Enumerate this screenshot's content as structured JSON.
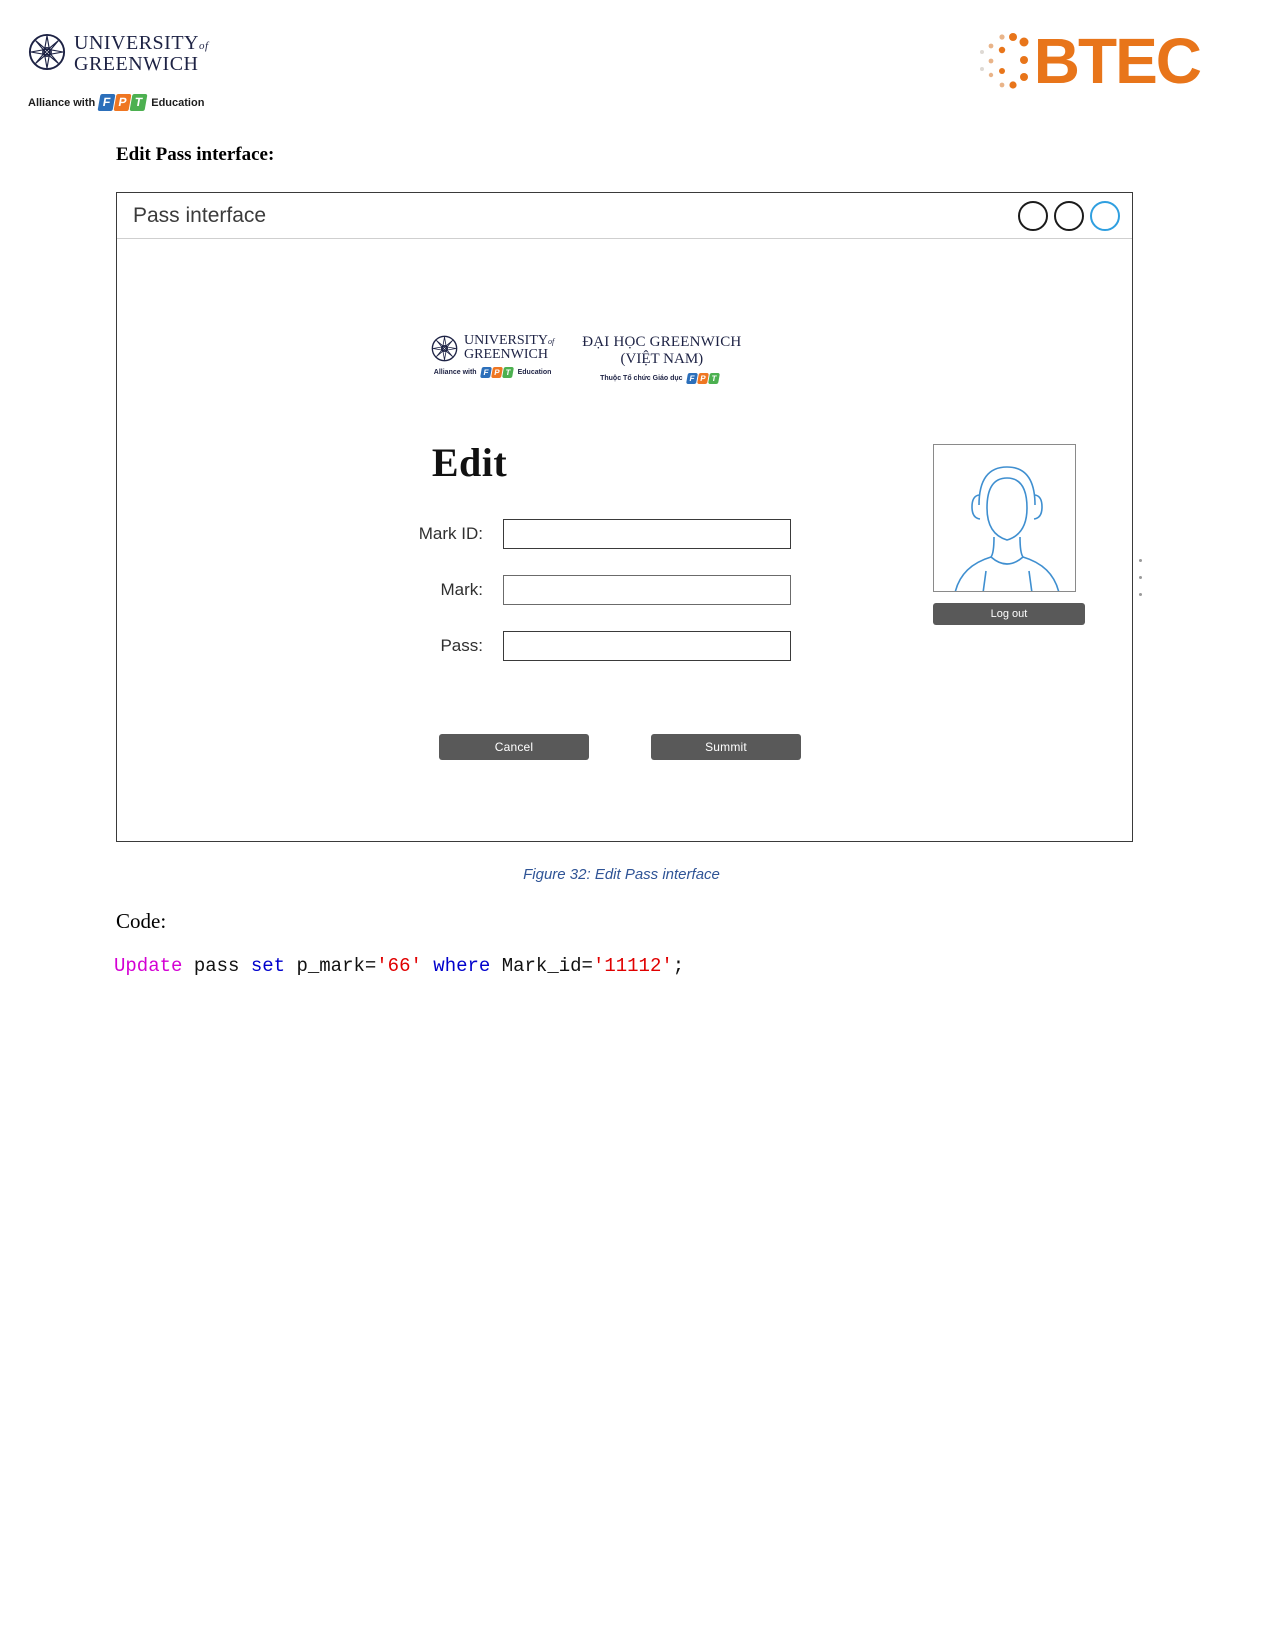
{
  "header": {
    "university": {
      "line1": "UNIVERSITY",
      "of": "of",
      "line2": "GREENWICH"
    },
    "alliance": {
      "prefix": "Alliance with",
      "f": "F",
      "p": "P",
      "t": "T",
      "suffix": "Education"
    },
    "btec": {
      "word": "BTEC",
      "color": "#e8751a"
    }
  },
  "document": {
    "section_title": "Edit Pass interface:",
    "figure_caption": "Figure 32: Edit Pass interface",
    "code_label": "Code:"
  },
  "window": {
    "title": "Pass interface",
    "controls": [
      {
        "name": "minimize",
        "color": "#1b1b1b"
      },
      {
        "name": "maximize",
        "color": "#1b1b1b"
      },
      {
        "name": "close",
        "color": "#2f9fe0"
      }
    ]
  },
  "form": {
    "logo_left": {
      "line1": "UNIVERSITY",
      "of": "of",
      "line2": "GREENWICH",
      "sub_prefix": "Alliance with",
      "sub_suffix": "Education"
    },
    "logo_right": {
      "line1": "ĐẠI HỌC GREENWICH",
      "line2": "(VIỆT NAM)",
      "sub_prefix": "Thuộc Tổ chức Giáo dục"
    },
    "heading": "Edit",
    "fields": [
      {
        "label": "Mark ID:",
        "value": "",
        "placeholder": ""
      },
      {
        "label": "Mark:",
        "value": "",
        "placeholder": ""
      },
      {
        "label": "Pass:",
        "value": "",
        "placeholder": ""
      }
    ],
    "buttons": {
      "cancel": "Cancel",
      "submit": "Summit"
    },
    "logout": "Log out"
  },
  "code": {
    "tokens": [
      {
        "text": "Update",
        "style": "kw-magenta"
      },
      {
        "text": " pass ",
        "style": "plain"
      },
      {
        "text": "set",
        "style": "kw-blue"
      },
      {
        "text": " p_mark=",
        "style": "plain"
      },
      {
        "text": "'66'",
        "style": "str"
      },
      {
        "text": " ",
        "style": "plain"
      },
      {
        "text": "where",
        "style": "kw-blue"
      },
      {
        "text": " Mark_id=",
        "style": "plain"
      },
      {
        "text": "'11112'",
        "style": "str"
      },
      {
        "text": ";",
        "style": "plain"
      }
    ],
    "full": "Update pass set p_mark='66' where Mark_id='11112';"
  }
}
